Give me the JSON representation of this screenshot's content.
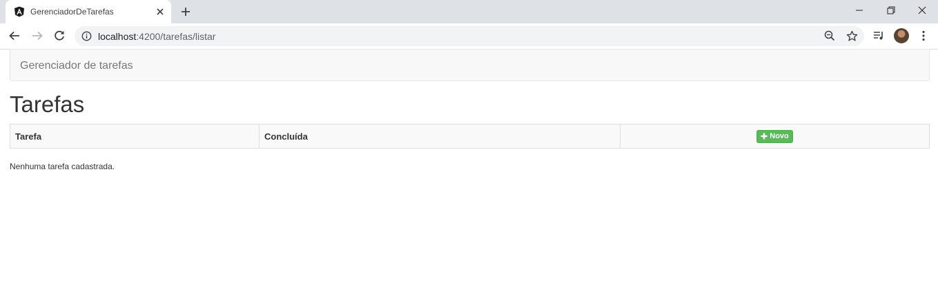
{
  "browser": {
    "tab_title": "GerenciadorDeTarefas",
    "url_host": "localhost",
    "url_rest": ":4200/tarefas/listar"
  },
  "navbar": {
    "brand": "Gerenciador de tarefas"
  },
  "page": {
    "title": "Tarefas",
    "table": {
      "headers": [
        "Tarefa",
        "Concluída"
      ],
      "new_button_label": "Novo"
    },
    "empty_message": "Nenhuma tarefa cadastrada."
  },
  "colors": {
    "success": "#5cb85c",
    "navbar_bg": "#f8f8f8",
    "tabstrip_bg": "#dee1e6"
  }
}
